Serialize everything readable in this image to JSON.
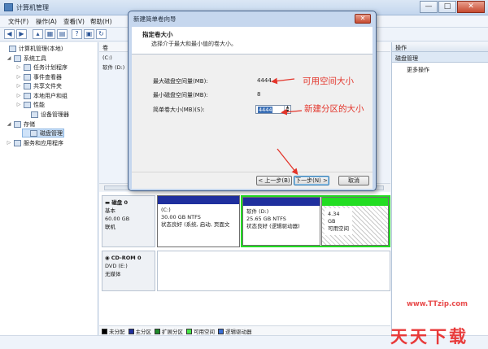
{
  "window": {
    "title": "计算机管理",
    "minimize": "—",
    "maximize": "□",
    "close": "✕"
  },
  "menu": [
    "文件(F)",
    "操作(A)",
    "查看(V)",
    "帮助(H)"
  ],
  "tree": {
    "items": [
      {
        "label": "计算机管理(本地)",
        "arrow": ""
      },
      {
        "label": "系统工具",
        "arrow": "◢"
      },
      {
        "label": "任务计划程序",
        "arrow": "▷"
      },
      {
        "label": "事件查看器",
        "arrow": "▷"
      },
      {
        "label": "共享文件夹",
        "arrow": "▷"
      },
      {
        "label": "本地用户和组",
        "arrow": "▷"
      },
      {
        "label": "性能",
        "arrow": "▷"
      },
      {
        "label": "设备管理器",
        "arrow": ""
      },
      {
        "label": "存储",
        "arrow": "◢"
      },
      {
        "label": "磁盘管理",
        "arrow": ""
      },
      {
        "label": "服务和应用程序",
        "arrow": "▷"
      }
    ]
  },
  "volumes": {
    "header": "卷",
    "rows": [
      "(C:)",
      "软件 (D:)"
    ]
  },
  "disks": [
    {
      "name": "磁盘 0",
      "type": "基本",
      "size": "60.00 GB",
      "status": "联机"
    },
    {
      "name": "CD-ROM 0",
      "type": "DVD (E:)",
      "size": "",
      "status": "无媒体"
    }
  ],
  "partitions": [
    {
      "name": "(C:)",
      "size": "30.00 GB NTFS",
      "status": "状态良好 (系统, 启动, 页面文",
      "bar": "#1f2f9e"
    },
    {
      "name": "软件 (D:)",
      "size": "25.65 GB NTFS",
      "status": "状态良好 (逻辑驱动器)",
      "bar": "#1f2f9e"
    },
    {
      "name": "",
      "size": "4.34 GB",
      "status": "可用空间",
      "bar": "#22dd22"
    }
  ],
  "legend": [
    {
      "label": "未分配",
      "color": "#000000"
    },
    {
      "label": "主分区",
      "color": "#1f2f9e"
    },
    {
      "label": "扩展分区",
      "color": "#1e8a2a"
    },
    {
      "label": "可用空间",
      "color": "#47e647"
    },
    {
      "label": "逻辑驱动器",
      "color": "#3a6fd6"
    }
  ],
  "actions": {
    "header": "操作",
    "sub": "磁盘管理",
    "more": "更多操作"
  },
  "dialog": {
    "title": "新建简单卷向导",
    "heading": "指定卷大小",
    "subheading": "选择介于最大和最小值的卷大小。",
    "max_label": "最大磁盘空间量(MB):",
    "max_value": "4444",
    "min_label": "最小磁盘空间量(MB):",
    "min_value": "8",
    "size_label": "简单卷大小(MB)(S):",
    "size_value": "4444",
    "back": "< 上一步(B)",
    "next": "下一步(N) >",
    "cancel": "取消"
  },
  "annotations": {
    "available": "可用空间大小",
    "new_size": "新建分区的大小"
  },
  "watermark": {
    "site": "www.TTzip.com",
    "text": "天天下载"
  },
  "colors": {
    "accent": "#e3342a",
    "primary_partition": "#1f2f9e",
    "free_space": "#22dd22"
  }
}
